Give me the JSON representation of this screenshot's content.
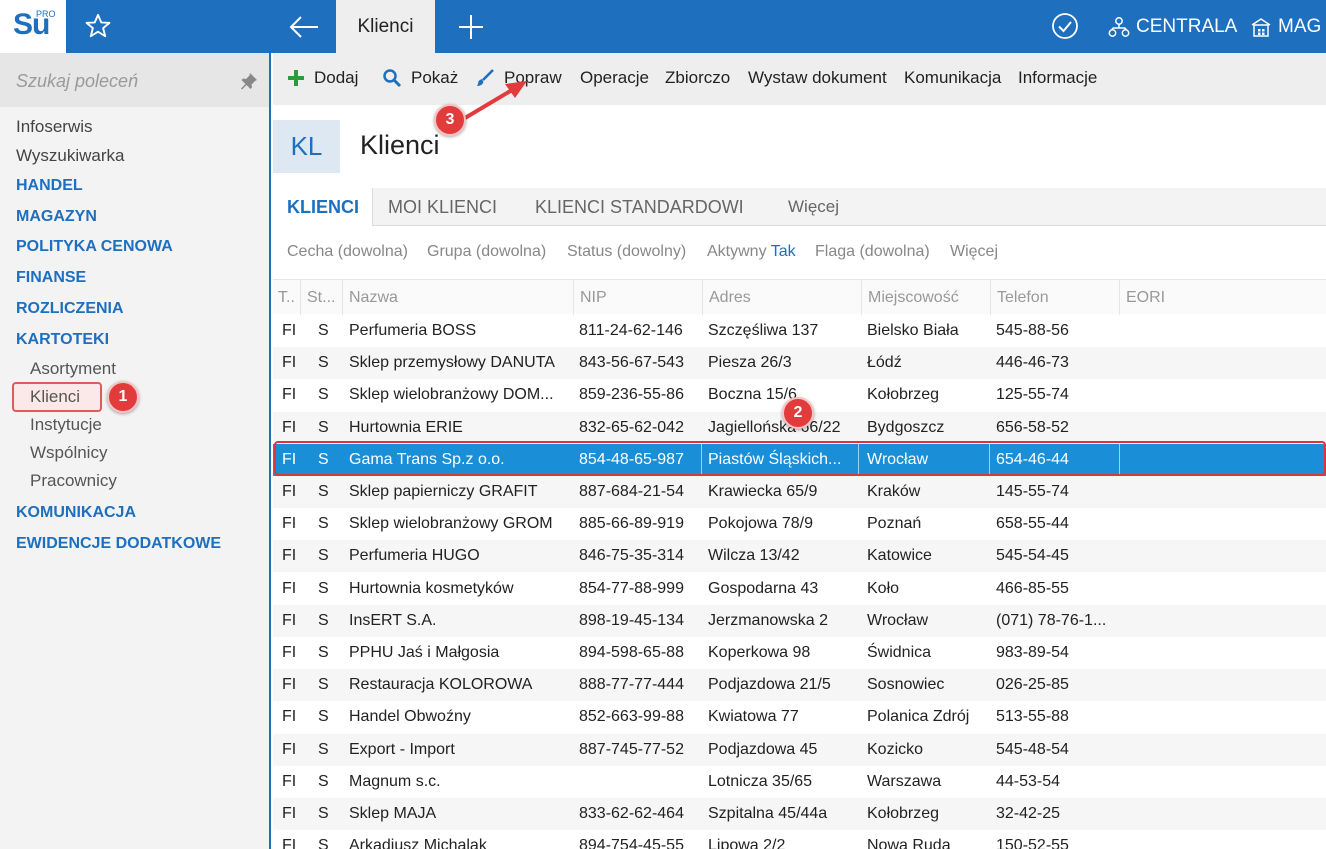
{
  "app": {
    "logo_text": "Su",
    "logo_sup": "PRO",
    "active_tab": "Klienci",
    "company": "CENTRALA",
    "warehouse": "MAG",
    "accent_color": "#1e6fbe"
  },
  "sidebar": {
    "search_placeholder": "Szukaj poleceń",
    "items": [
      {
        "label": "Infoserwis"
      },
      {
        "label": "Wyszukiwarka"
      },
      {
        "label": "HANDEL"
      },
      {
        "label": "MAGAZYN"
      },
      {
        "label": "POLITYKA CENOWA"
      },
      {
        "label": "FINANSE"
      },
      {
        "label": "ROZLICZENIA"
      },
      {
        "label": "KARTOTEKI"
      },
      {
        "label": "Asortyment"
      },
      {
        "label": "Klienci"
      },
      {
        "label": "Instytucje"
      },
      {
        "label": "Wspólnicy"
      },
      {
        "label": "Pracownicy"
      },
      {
        "label": "KOMUNIKACJA"
      },
      {
        "label": "EWIDENCJE DODATKOWE"
      }
    ]
  },
  "toolbar": {
    "add": "Dodaj",
    "show": "Pokaż",
    "edit": "Popraw",
    "operations": "Operacje",
    "bulk": "Zbiorczo",
    "issue_doc": "Wystaw dokument",
    "communication": "Komunikacja",
    "information": "Informacje"
  },
  "title": {
    "badge": "KL",
    "text": "Klienci"
  },
  "tabs": [
    {
      "label": "KLIENCI"
    },
    {
      "label": "MOI KLIENCI"
    },
    {
      "label": "KLIENCI STANDARDOWI"
    },
    {
      "label": "Więcej"
    }
  ],
  "filters": {
    "feature": "Cecha (dowolna)",
    "group": "Grupa (dowolna)",
    "status": "Status (dowolny)",
    "active_label": "Aktywny",
    "active_value": "Tak",
    "flag": "Flaga (dowolna)",
    "more": "Więcej"
  },
  "table": {
    "columns": [
      "T..",
      "St...",
      "Nazwa",
      "NIP",
      "Adres",
      "Miejscowość",
      "Telefon",
      "EORI"
    ],
    "rows": [
      [
        "FI",
        "S",
        "Perfumeria BOSS",
        "811-24-62-146",
        "Szczęśliwa  137",
        "Bielsko Biała",
        "545-88-56"
      ],
      [
        "FI",
        "S",
        "Sklep przemysłowy DANUTA",
        "843-56-67-543",
        "Piesza  26/3",
        "Łódź",
        "446-46-73"
      ],
      [
        "FI",
        "S",
        "Sklep wielobranżowy DOM...",
        "859-236-55-86",
        "Boczna  15/6",
        "Kołobrzeg",
        "125-55-74"
      ],
      [
        "FI",
        "S",
        "Hurtownia ERIE",
        "832-65-62-042",
        "Jagiellońska  66/22",
        "Bydgoszcz",
        "656-58-52"
      ],
      [
        "FI",
        "S",
        "Gama Trans Sp.z o.o.",
        "854-48-65-987",
        "Piastów Śląskich...",
        "Wrocław",
        "654-46-44"
      ],
      [
        "FI",
        "S",
        "Sklep papierniczy GRAFIT",
        "887-684-21-54",
        "Krawiecka  65/9",
        "Kraków",
        "145-55-74"
      ],
      [
        "FI",
        "S",
        "Sklep wielobranżowy GROM",
        "885-66-89-919",
        "Pokojowa  78/9",
        "Poznań",
        "658-55-44"
      ],
      [
        "FI",
        "S",
        "Perfumeria HUGO",
        "846-75-35-314",
        "Wilcza  13/42",
        "Katowice",
        "545-54-45"
      ],
      [
        "FI",
        "S",
        "Hurtownia kosmetyków",
        "854-77-88-999",
        "Gospodarna  43",
        "Koło",
        "466-85-55"
      ],
      [
        "FI",
        "S",
        "InsERT S.A.",
        "898-19-45-134",
        "Jerzmanowska 2",
        "Wrocław",
        "(071) 78-76-1..."
      ],
      [
        "FI",
        "S",
        "PPHU Jaś i Małgosia",
        "894-598-65-88",
        "Koperkowa  98",
        "Świdnica",
        "983-89-54"
      ],
      [
        "FI",
        "S",
        "Restauracja KOLOROWA",
        "888-77-77-444",
        "Podjazdowa  21/5",
        "Sosnowiec",
        "026-25-85"
      ],
      [
        "FI",
        "S",
        "Handel Obwoźny",
        "852-663-99-88",
        "Kwiatowa  77",
        "Polanica Zdrój",
        "513-55-88"
      ],
      [
        "FI",
        "S",
        "Export - Import",
        "887-745-77-52",
        "Podjazdowa 45",
        "Kozicko",
        "545-48-54"
      ],
      [
        "FI",
        "S",
        "Magnum s.c.",
        "",
        "Lotnicza  35/65",
        "Warszawa",
        "44-53-54"
      ],
      [
        "FI",
        "S",
        "Sklep MAJA",
        "833-62-62-464",
        "Szpitalna  45/44a",
        "Kołobrzeg",
        "32-42-25"
      ],
      [
        "FI",
        "S",
        "Arkadiusz Michalak",
        "894-754-45-55",
        "Lipowa  2/2",
        "Nowa Ruda",
        "150-52-55"
      ]
    ],
    "selected_row": 4
  },
  "annotations": {
    "m1": "1",
    "m2": "2",
    "m3": "3",
    "marker_color": "#e23b3b"
  }
}
